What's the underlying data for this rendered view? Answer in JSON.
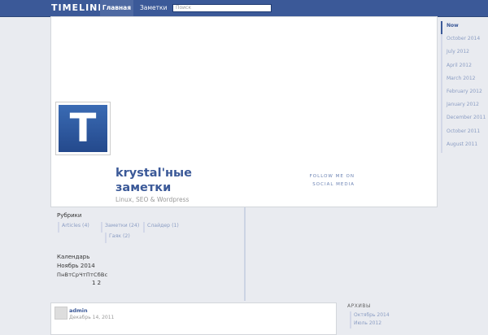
{
  "topbar": {
    "logo": "TIMELINE",
    "nav": [
      "Главная",
      "Заметки"
    ],
    "search_placeholder": "Поиск"
  },
  "cover": {
    "avatar_letter": "T",
    "title": "krystal'ные заметки",
    "description": "Linux, SEO & Wordpress",
    "follow": "FOLLOW ME ON SOCIAL MEDIA"
  },
  "timeline": [
    "Now",
    "October 2014",
    "July 2012",
    "April 2012",
    "March 2012",
    "February 2012",
    "January 2012",
    "December 2011",
    "October 2011",
    "August 2011"
  ],
  "widgets": {
    "categories_title": "Рубрики",
    "categories": [
      "Articles (4)",
      "Заметки (24)",
      "Слайдер (1)",
      "Гаяк (2)"
    ],
    "calendar_title": "Календарь",
    "calendar_month": "Ноябрь 2014",
    "calendar_weekdays": "ПнВтСрЧтПтСбВс",
    "calendar_days": "1  2"
  },
  "post": {
    "author": "admin",
    "date": "Декабрь 14, 2011"
  },
  "archives": {
    "title": "АРХИВЫ",
    "items": [
      "Октябрь 2014",
      "Июль 2012"
    ]
  },
  "colors": {
    "brand": "#3b5998",
    "link": "#8b9dc3",
    "background": "#e9ebf0"
  }
}
